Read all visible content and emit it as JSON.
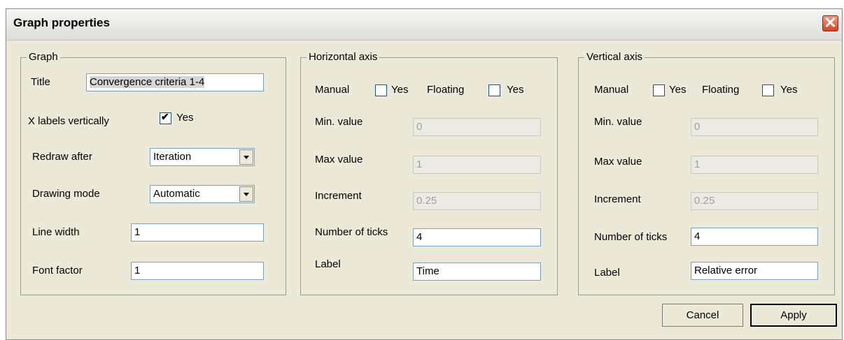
{
  "window": {
    "title": "Graph properties"
  },
  "graph": {
    "legend": "Graph",
    "title_label": "Title",
    "title_value": "Convergence criteria 1-4",
    "xlabels_label": "X labels vertically",
    "xlabels_checked": true,
    "yes": "Yes",
    "redraw_label": "Redraw after",
    "redraw_value": "Iteration",
    "drawing_label": "Drawing mode",
    "drawing_value": "Automatic",
    "linewidth_label": "Line width",
    "linewidth_value": "1",
    "fontfactor_label": "Font factor",
    "fontfactor_value": "1"
  },
  "haxis": {
    "legend": "Horizontal axis",
    "manual_label": "Manual",
    "yes": "Yes",
    "floating_label": "Floating",
    "min_label": "Min. value",
    "min_value": "0",
    "max_label": "Max value",
    "max_value": "1",
    "inc_label": "Increment",
    "inc_value": "0.25",
    "ticks_label": "Number of ticks",
    "ticks_value": "4",
    "label_label": "Label",
    "label_value": "Time"
  },
  "vaxis": {
    "legend": "Vertical axis",
    "manual_label": "Manual",
    "yes": "Yes",
    "floating_label": "Floating",
    "min_label": "Min. value",
    "min_value": "0",
    "max_label": "Max value",
    "max_value": "1",
    "inc_label": "Increment",
    "inc_value": "0.25",
    "ticks_label": "Number of ticks",
    "ticks_value": "4",
    "label_label": "Label",
    "label_value": "Relative error"
  },
  "buttons": {
    "cancel": "Cancel",
    "apply": "Apply"
  },
  "icons": {
    "close": "close-icon",
    "check": "checkmark-icon",
    "dropdown": "chevron-down-icon"
  }
}
